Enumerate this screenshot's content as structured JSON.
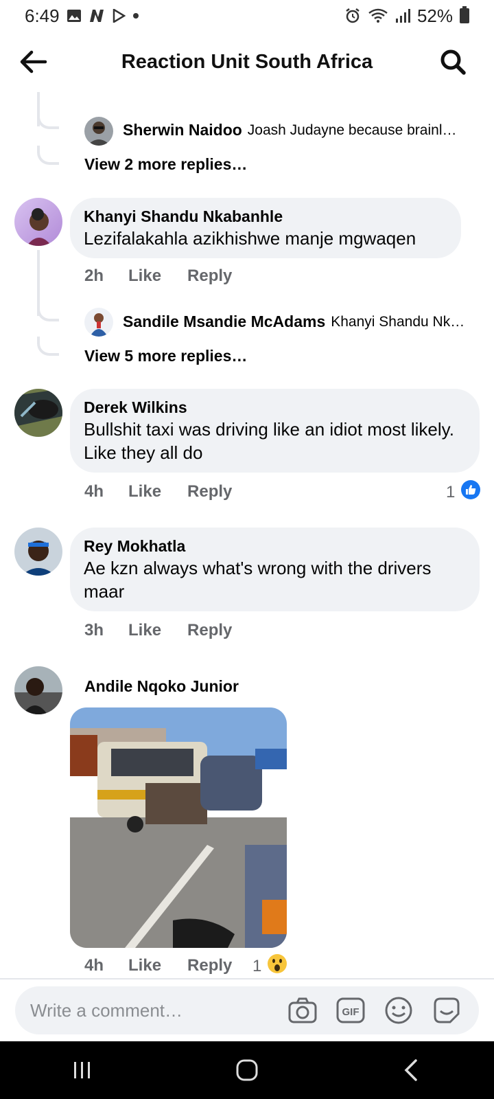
{
  "status": {
    "time": "6:49",
    "battery": "52%"
  },
  "header": {
    "title": "Reaction Unit South Africa"
  },
  "thread1": {
    "reply": {
      "name": "Sherwin Naidoo",
      "text": "Joash Judayne because brainl…"
    },
    "view_more": "View 2 more replies…"
  },
  "comments": [
    {
      "name": "Khanyi Shandu Nkabanhle",
      "text": "Lezifalakahla azikhishwe manje mgwaqen",
      "time": "2h",
      "like": "Like",
      "reply": "Reply",
      "sub_reply": {
        "name": "Sandile Msandie McAdams",
        "text": "Khanyi Shandu Nk…"
      },
      "view_more": "View 5 more replies…"
    },
    {
      "name": "Derek Wilkins",
      "text": "Bullshit taxi was driving like an idiot most likely. Like they all do",
      "time": "4h",
      "like": "Like",
      "reply": "Reply",
      "reaction_count": "1",
      "reaction_icon": "like-icon"
    },
    {
      "name": "Rey Mokhatla",
      "text": "Ae kzn always what's wrong with the drivers maar",
      "time": "3h",
      "like": "Like",
      "reply": "Reply"
    },
    {
      "name": "Andile Nqoko Junior",
      "time": "4h",
      "like": "Like",
      "reply": "Reply",
      "reaction_count": "1",
      "reaction_icon": "wow-icon"
    }
  ],
  "composer": {
    "placeholder": "Write a comment…"
  },
  "colors": {
    "bubble": "#f0f2f5",
    "meta": "#65676b",
    "like_blue": "#1877f2"
  }
}
